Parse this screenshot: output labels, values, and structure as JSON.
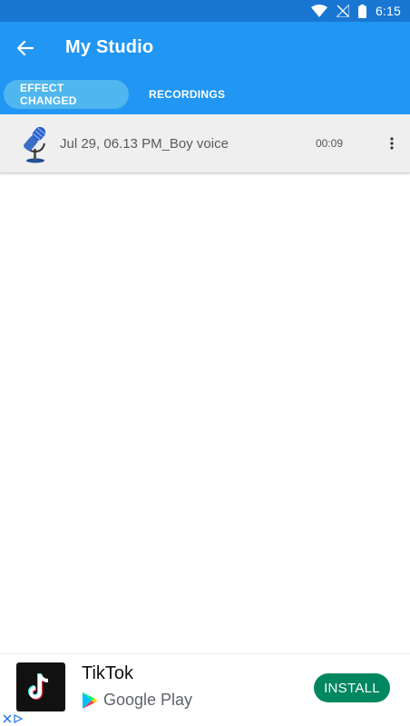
{
  "status_bar": {
    "time": "6:15",
    "icons": [
      "wifi-icon",
      "no-signal-icon",
      "battery-icon"
    ]
  },
  "app_bar": {
    "title": "My Studio",
    "back_icon": "arrow-left-icon"
  },
  "tabs": [
    {
      "label": "EFFECT CHANGED",
      "active": true
    },
    {
      "label": "RECORDINGS",
      "active": false
    }
  ],
  "recordings": [
    {
      "title": "Jul 29, 06.13 PM_Boy voice",
      "duration": "00:09",
      "icon": "microphone-icon"
    }
  ],
  "ad": {
    "app_name": "TikTok",
    "store_label": "Google Play",
    "install_label": "INSTALL",
    "colors": {
      "install": "#01875F",
      "app_bar": "#2196F3",
      "status_bar": "#1976D2"
    }
  }
}
